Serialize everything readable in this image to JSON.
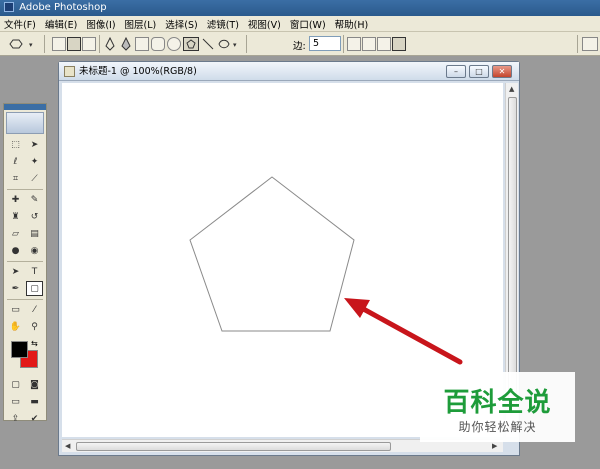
{
  "app": {
    "title": "Adobe Photoshop"
  },
  "menu": [
    "文件(F)",
    "编辑(E)",
    "图像(I)",
    "图层(L)",
    "选择(S)",
    "滤镜(T)",
    "视图(V)",
    "窗口(W)",
    "帮助(H)"
  ],
  "options": {
    "sides_label": "边:",
    "sides_value": "5"
  },
  "document": {
    "title": "未标题-1 @ 100%(RGB/8)"
  },
  "colors": {
    "foreground": "#000000",
    "background": "#e21818",
    "accent": "#c8151b",
    "watermark": "#1e9c3a"
  },
  "watermark": {
    "main": "百科全说",
    "sub": "助你轻松解决"
  },
  "canvas": {
    "shape": "pentagon",
    "annotation": "red-arrow"
  }
}
